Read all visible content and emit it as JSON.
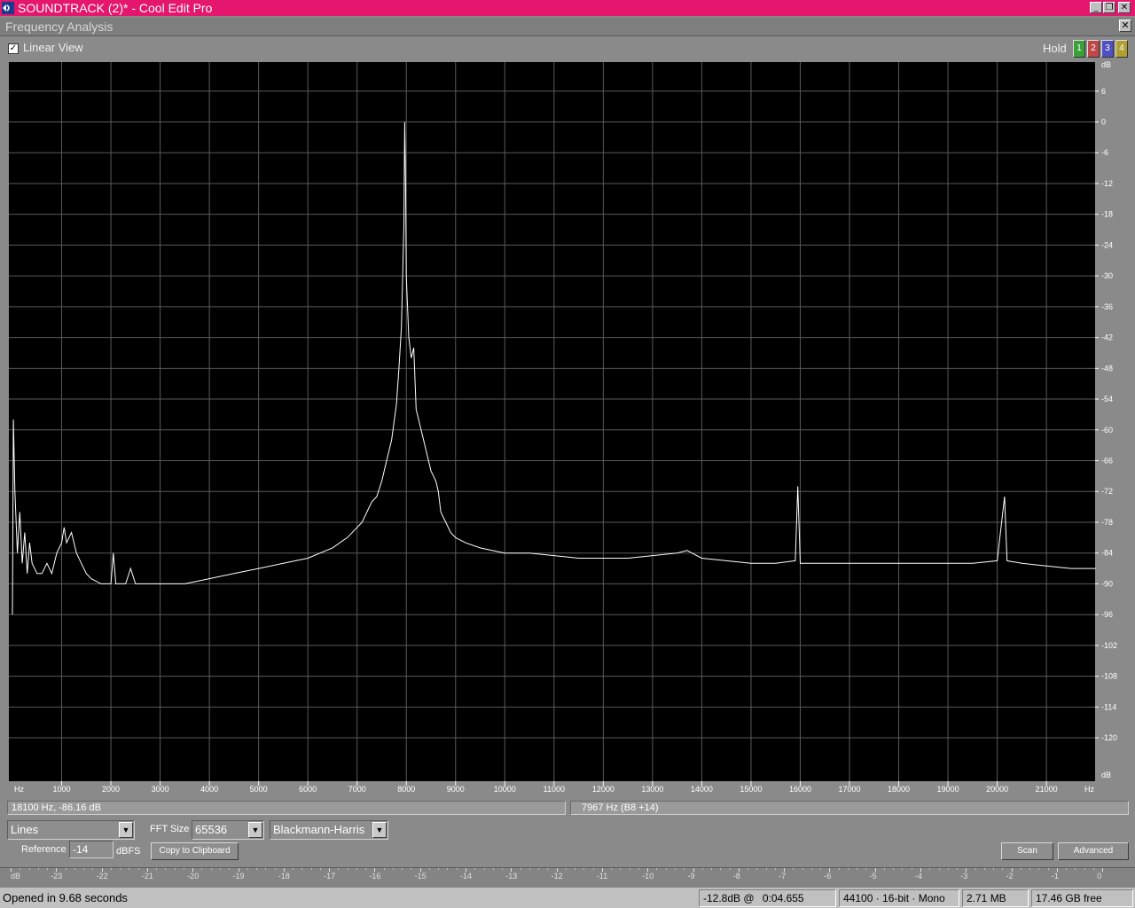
{
  "window": {
    "title": "SOUNDTRACK (2)* - Cool Edit Pro",
    "controls": [
      "_",
      "❐",
      "✕"
    ]
  },
  "panel": {
    "title": "Frequency Analysis",
    "close": "✕"
  },
  "linear_view": {
    "label": "Linear View",
    "checked": true,
    "mark": "✓"
  },
  "hold": {
    "label": "Hold",
    "buttons": [
      {
        "label": "1",
        "color": "#3aa03a"
      },
      {
        "label": "2",
        "color": "#c04848"
      },
      {
        "label": "3",
        "color": "#5050c0"
      },
      {
        "label": "4",
        "color": "#b0a030"
      }
    ]
  },
  "chart_data": {
    "type": "line",
    "x_unit": "Hz",
    "y_unit": "dB",
    "xlim": [
      0,
      22050
    ],
    "ylim": [
      -126,
      12
    ],
    "x_ticks": [
      1000,
      2000,
      3000,
      4000,
      5000,
      6000,
      7000,
      8000,
      9000,
      10000,
      11000,
      12000,
      13000,
      14000,
      15000,
      16000,
      17000,
      18000,
      19000,
      20000,
      21000
    ],
    "y_ticks": [
      6,
      0,
      -6,
      -12,
      -18,
      -24,
      -30,
      -36,
      -42,
      -48,
      -54,
      -60,
      -66,
      -72,
      -78,
      -84,
      -90,
      -96,
      -102,
      -108,
      -114,
      -120
    ],
    "grid": true,
    "series": [
      {
        "color": "#ffffff",
        "points": [
          [
            0,
            -96
          ],
          [
            20,
            -58
          ],
          [
            50,
            -72
          ],
          [
            100,
            -84
          ],
          [
            150,
            -76
          ],
          [
            200,
            -86
          ],
          [
            250,
            -80
          ],
          [
            300,
            -88
          ],
          [
            350,
            -82
          ],
          [
            400,
            -86
          ],
          [
            500,
            -88
          ],
          [
            600,
            -88
          ],
          [
            700,
            -86
          ],
          [
            800,
            -88
          ],
          [
            900,
            -84
          ],
          [
            1000,
            -82
          ],
          [
            1050,
            -79
          ],
          [
            1100,
            -82
          ],
          [
            1200,
            -80
          ],
          [
            1300,
            -84
          ],
          [
            1400,
            -86
          ],
          [
            1500,
            -88
          ],
          [
            1600,
            -89
          ],
          [
            1800,
            -90
          ],
          [
            2000,
            -90
          ],
          [
            2050,
            -84
          ],
          [
            2100,
            -90
          ],
          [
            2300,
            -90
          ],
          [
            2400,
            -87
          ],
          [
            2500,
            -90
          ],
          [
            3000,
            -90
          ],
          [
            3500,
            -90
          ],
          [
            4000,
            -89
          ],
          [
            4500,
            -88
          ],
          [
            5000,
            -87
          ],
          [
            5500,
            -86
          ],
          [
            6000,
            -85
          ],
          [
            6500,
            -83
          ],
          [
            6800,
            -81
          ],
          [
            7000,
            -79
          ],
          [
            7100,
            -78
          ],
          [
            7200,
            -76
          ],
          [
            7300,
            -74
          ],
          [
            7400,
            -73
          ],
          [
            7500,
            -70
          ],
          [
            7600,
            -66
          ],
          [
            7700,
            -62
          ],
          [
            7800,
            -55
          ],
          [
            7850,
            -48
          ],
          [
            7900,
            -40
          ],
          [
            7950,
            -20
          ],
          [
            7967,
            0
          ],
          [
            7985,
            -12
          ],
          [
            8000,
            -30
          ],
          [
            8050,
            -42
          ],
          [
            8100,
            -46
          ],
          [
            8150,
            -44
          ],
          [
            8200,
            -56
          ],
          [
            8300,
            -60
          ],
          [
            8400,
            -64
          ],
          [
            8500,
            -68
          ],
          [
            8600,
            -70
          ],
          [
            8650,
            -72
          ],
          [
            8700,
            -76
          ],
          [
            8800,
            -78
          ],
          [
            8900,
            -80
          ],
          [
            9000,
            -81
          ],
          [
            9200,
            -82
          ],
          [
            9500,
            -83
          ],
          [
            10000,
            -84
          ],
          [
            10500,
            -84
          ],
          [
            11000,
            -84.5
          ],
          [
            11500,
            -85
          ],
          [
            12000,
            -85
          ],
          [
            12500,
            -85
          ],
          [
            13000,
            -84.5
          ],
          [
            13500,
            -84
          ],
          [
            13700,
            -83.5
          ],
          [
            14000,
            -85
          ],
          [
            14500,
            -85.5
          ],
          [
            15000,
            -86
          ],
          [
            15500,
            -86
          ],
          [
            15900,
            -85.5
          ],
          [
            15950,
            -71
          ],
          [
            16000,
            -86
          ],
          [
            16500,
            -86
          ],
          [
            17000,
            -86
          ],
          [
            17500,
            -86
          ],
          [
            18000,
            -86
          ],
          [
            18500,
            -86
          ],
          [
            19000,
            -86
          ],
          [
            19500,
            -86
          ],
          [
            20000,
            -85.5
          ],
          [
            20150,
            -73
          ],
          [
            20200,
            -85.5
          ],
          [
            20500,
            -86
          ],
          [
            21000,
            -86.5
          ],
          [
            21500,
            -87
          ],
          [
            22000,
            -87
          ]
        ]
      }
    ]
  },
  "status": {
    "cursor_readout": "18100 Hz, -86.16 dB",
    "peak_readout": "7967 Hz (B8 +14)"
  },
  "controls": {
    "plot_style": "Lines",
    "fft_label": "FFT Size",
    "fft_size": "65536",
    "window_func": "Blackmann-Harris",
    "reference_label": "Reference",
    "reference_value": "-14",
    "reference_unit": "dBFS",
    "copy_button": "Copy to Clipboard",
    "scan_button": "Scan",
    "advanced_button": "Advanced",
    "dropdown_arrow": "▼"
  },
  "level_meter": {
    "ticks": [
      "dB",
      "-23",
      "-22",
      "-21",
      "-20",
      "-19",
      "-18",
      "-17",
      "-16",
      "-15",
      "-14",
      "-13",
      "-12",
      "-11",
      "-10",
      "-9",
      "-8",
      "-7",
      "-6",
      "-5",
      "-4",
      "-3",
      "-2",
      "-1",
      "0"
    ]
  },
  "statusbar": {
    "message": "Opened in 9.68 seconds",
    "level": "-12.8dB @",
    "time": "0:04.655",
    "format": "44100 · 16-bit · Mono",
    "size": "2.71 MB",
    "free": "17.46 GB free"
  }
}
